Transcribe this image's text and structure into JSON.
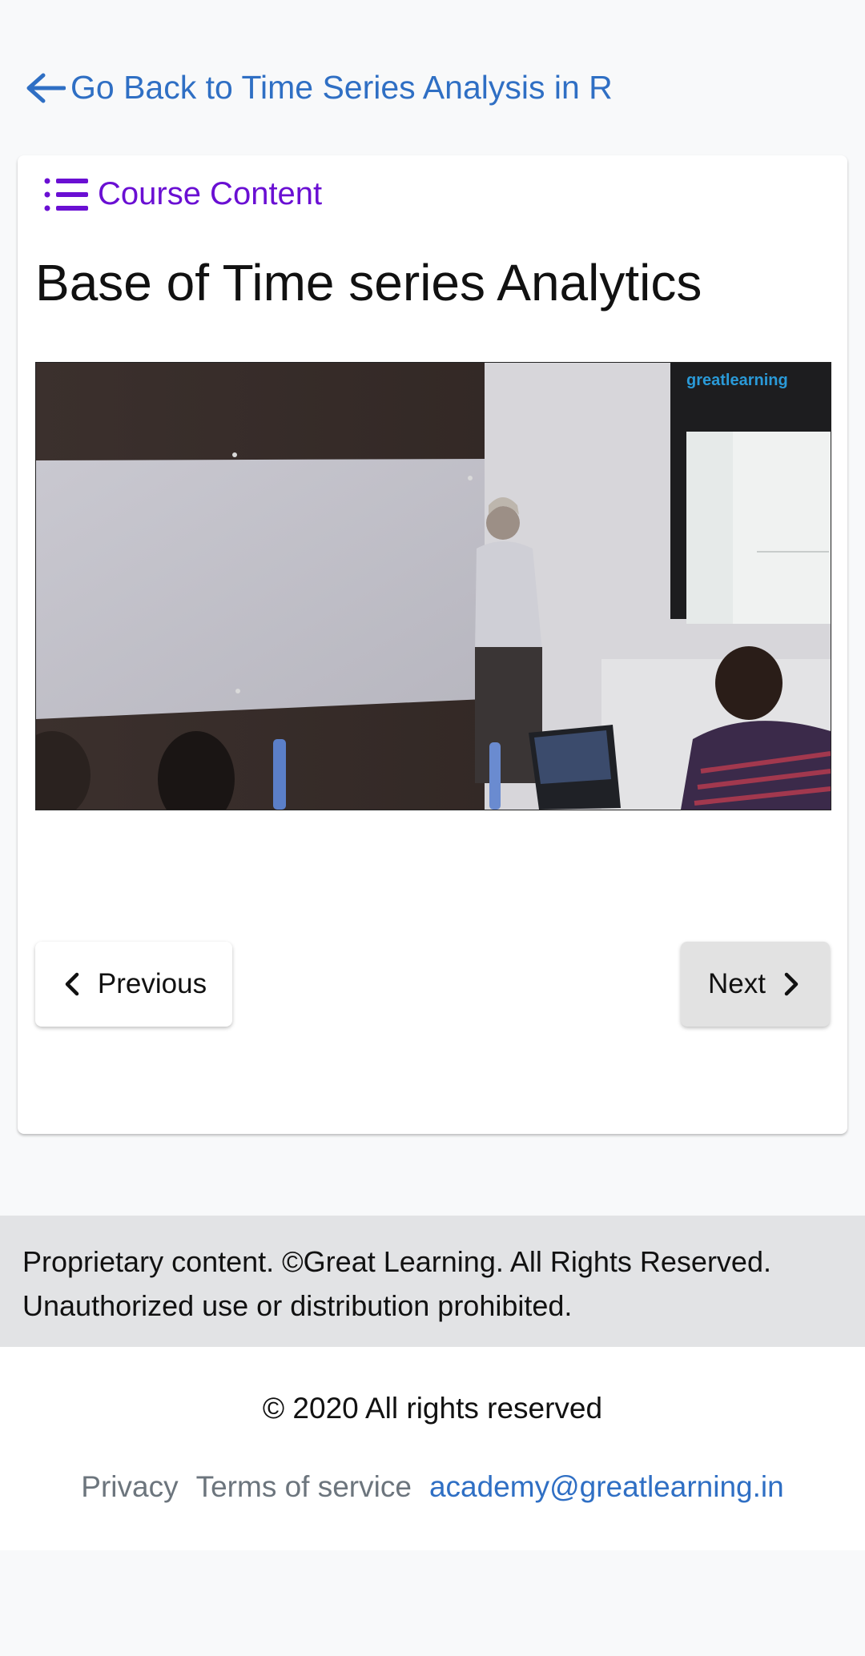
{
  "back_link": {
    "label": "Go Back to Time Series Analysis in R"
  },
  "course_content": {
    "label": "Course Content"
  },
  "lesson": {
    "title": "Base of Time series Analytics"
  },
  "video": {
    "watermark": "greatlearning"
  },
  "navigation": {
    "previous_label": "Previous",
    "next_label": "Next"
  },
  "notice": {
    "text": "Proprietary content. ©Great Learning. All Rights Reserved. Unauthorized use or distribution prohibited."
  },
  "footer": {
    "copyright": "© 2020 All rights reserved",
    "privacy": "Privacy",
    "terms": "Terms of service",
    "email": "academy@greatlearning.in"
  },
  "colors": {
    "link": "#2f6fc4",
    "accent_purple": "#6a0fd3",
    "notice_bg": "#e2e3e5"
  },
  "icons": [
    "arrow-left-icon",
    "list-icon",
    "chevron-left-icon",
    "chevron-right-icon"
  ]
}
